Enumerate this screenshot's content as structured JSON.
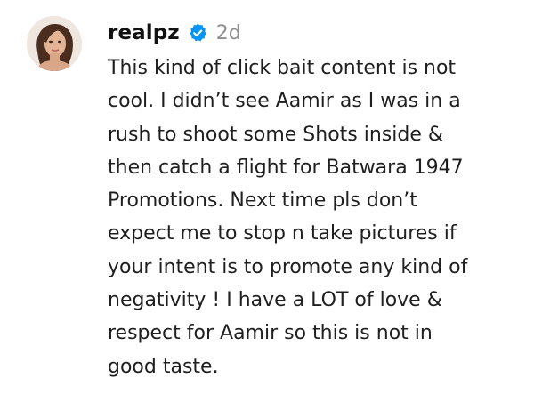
{
  "comment": {
    "username": "realpz",
    "verified": true,
    "timestamp": "2d",
    "lines": [
      "This kind of click bait content is not",
      "cool. I didn’t see Aamir as I was in a",
      "rush to shoot some Shots inside &",
      "then catch a flight for Batwara 1947",
      "Promotions. Next time pls don’t",
      "expect me to stop n take pictures if",
      "your intent is to promote any kind of",
      "negativity ! I have a LOT of love &",
      "respect for Aamir so this is not in",
      "good taste."
    ]
  },
  "colors": {
    "verified_badge": "#0095f6",
    "timestamp": "#8e8e8e",
    "text": "#1f1f1f"
  },
  "icons": {
    "avatar": "profile-photo",
    "verified": "verified-badge-icon"
  }
}
